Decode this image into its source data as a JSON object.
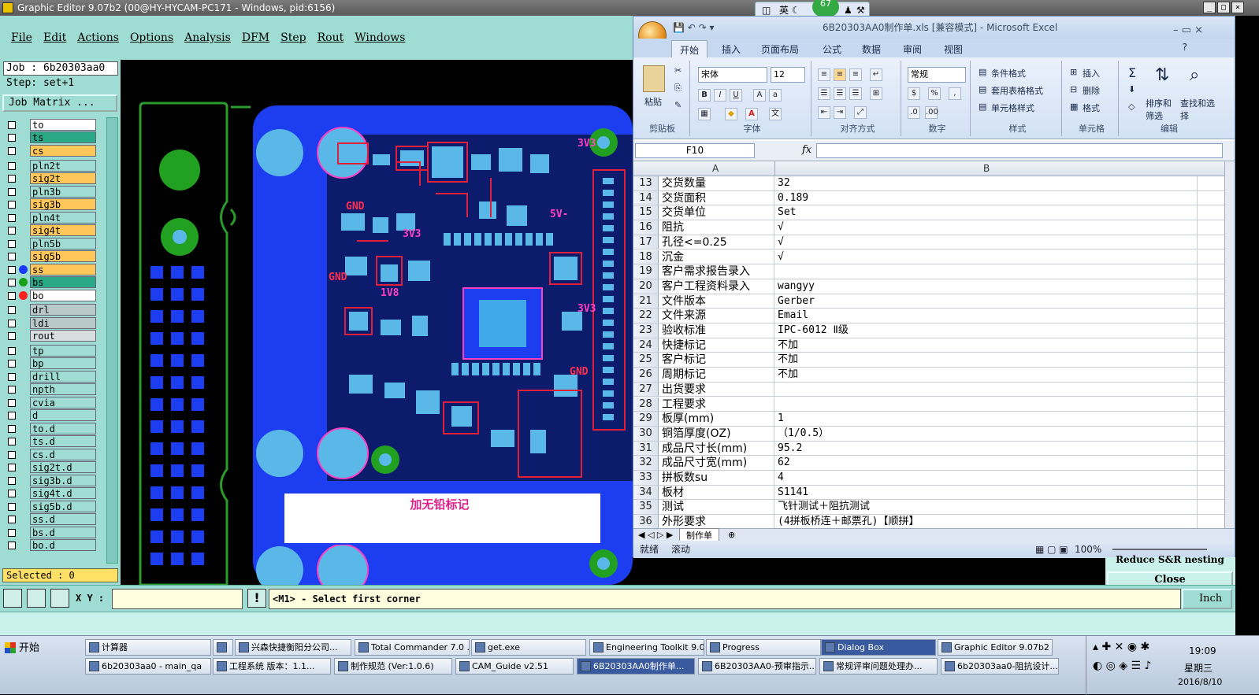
{
  "ge": {
    "title": "Graphic Editor 9.07b2 (00@HY-HYCAM-PC171 - Windows, pid:6156)",
    "menu": [
      "File",
      "Edit",
      "Actions",
      "Options",
      "Analysis",
      "DFM",
      "Step",
      "Rout",
      "Windows"
    ],
    "job": "Job : 6b20303aa0",
    "step": "Step: set+1",
    "job_matrix": "Job Matrix ...",
    "layers": [
      {
        "name": "to",
        "bg": "#ffffff"
      },
      {
        "name": "ts",
        "bg": "#2aa888"
      },
      {
        "name": "cs",
        "bg": "#ffc75a"
      },
      {
        "name": "pln2t",
        "bg": "#9fdcd4"
      },
      {
        "name": "sig2t",
        "bg": "#ffc75a"
      },
      {
        "name": "pln3b",
        "bg": "#9fdcd4"
      },
      {
        "name": "sig3b",
        "bg": "#ffc75a"
      },
      {
        "name": "pln4t",
        "bg": "#9fdcd4"
      },
      {
        "name": "sig4t",
        "bg": "#ffc75a"
      },
      {
        "name": "pln5b",
        "bg": "#9fdcd4"
      },
      {
        "name": "sig5b",
        "bg": "#ffc75a"
      },
      {
        "name": "ss",
        "bg": "#ffc75a",
        "dot": "#1a3aff"
      },
      {
        "name": "bs",
        "bg": "#2aa888",
        "dot": "#18a018"
      },
      {
        "name": "bo",
        "bg": "#ffffff",
        "dot": "#ff2020"
      },
      {
        "name": "drl",
        "bg": "#b9c9c9"
      },
      {
        "name": "ldi",
        "bg": "#b9c9c9"
      },
      {
        "name": "rout",
        "bg": "#d6dede"
      },
      {
        "name": "tp",
        "bg": "#9fdcd4"
      },
      {
        "name": "bp",
        "bg": "#9fdcd4"
      },
      {
        "name": "drill",
        "bg": "#9fdcd4"
      },
      {
        "name": "npth",
        "bg": "#9fdcd4"
      },
      {
        "name": "cvia",
        "bg": "#9fdcd4"
      },
      {
        "name": "d",
        "bg": "#9fdcd4"
      },
      {
        "name": "to.d",
        "bg": "#9fdcd4"
      },
      {
        "name": "ts.d",
        "bg": "#9fdcd4"
      },
      {
        "name": "cs.d",
        "bg": "#9fdcd4"
      },
      {
        "name": "sig2t.d",
        "bg": "#9fdcd4"
      },
      {
        "name": "sig3b.d",
        "bg": "#9fdcd4"
      },
      {
        "name": "sig4t.d",
        "bg": "#9fdcd4"
      },
      {
        "name": "sig5b.d",
        "bg": "#9fdcd4"
      },
      {
        "name": "ss.d",
        "bg": "#9fdcd4"
      },
      {
        "name": "bs.d",
        "bg": "#9fdcd4"
      },
      {
        "name": "bo.d",
        "bg": "#9fdcd4"
      }
    ],
    "selected": "Selected : 0",
    "xy_label": "X Y :",
    "prompt": "<M1> - Select first corner",
    "unit": "Inch",
    "pcb_note": "加无铅标记",
    "side_buttons": [
      "Reduce S&R nesting",
      "Close"
    ],
    "silk_labels": [
      "GND",
      "3V3",
      "5V-",
      "1V8",
      "GND",
      "3V3",
      "GND",
      "3V3"
    ]
  },
  "excel": {
    "title": "6B20303AA0制作单.xls [兼容模式] - Microsoft Excel",
    "tabs": [
      "开始",
      "插入",
      "页面布局",
      "公式",
      "数据",
      "审阅",
      "视图"
    ],
    "groups": [
      "剪贴板",
      "字体",
      "对齐方式",
      "数字",
      "样式",
      "单元格",
      "编辑"
    ],
    "paste": "粘贴",
    "font": "宋体",
    "size": "12",
    "numfmt": "常规",
    "style_items": [
      "条件格式",
      "套用表格格式",
      "单元格样式"
    ],
    "cell_items": [
      "插入",
      "删除",
      "格式"
    ],
    "edit_items": [
      "排序和筛选",
      "查找和选择"
    ],
    "namebox": "F10",
    "fx": "fx",
    "colA": "A",
    "colB": "B",
    "rows": [
      {
        "n": "13",
        "a": "交货数量",
        "b": "32"
      },
      {
        "n": "14",
        "a": "交货面积",
        "b": "0.189"
      },
      {
        "n": "15",
        "a": "交货单位",
        "b": "Set"
      },
      {
        "n": "16",
        "a": "阻抗",
        "b": "√"
      },
      {
        "n": "17",
        "a": "孔径<=0.25",
        "b": "√"
      },
      {
        "n": "18",
        "a": "沉金",
        "b": "√"
      },
      {
        "n": "19",
        "a": "客户需求报告录入",
        "b": ""
      },
      {
        "n": "20",
        "a": "客户工程资料录入",
        "b": "wangyy"
      },
      {
        "n": "21",
        "a": "文件版本",
        "b": "Gerber"
      },
      {
        "n": "22",
        "a": "文件来源",
        "b": "Email"
      },
      {
        "n": "23",
        "a": "验收标准",
        "b": "IPC-6012 Ⅱ级"
      },
      {
        "n": "24",
        "a": "快捷标记",
        "b": "不加"
      },
      {
        "n": "25",
        "a": "客户标记",
        "b": "不加"
      },
      {
        "n": "26",
        "a": "周期标记",
        "b": "不加"
      },
      {
        "n": "27",
        "a": "出货要求",
        "b": ""
      },
      {
        "n": "28",
        "a": "工程要求",
        "b": ""
      },
      {
        "n": "29",
        "a": "板厚(mm)",
        "b": "1"
      },
      {
        "n": "30",
        "a": "铜箔厚度(OZ)",
        "b": "（1/0.5）"
      },
      {
        "n": "31",
        "a": "成品尺寸长(mm)",
        "b": "95.2"
      },
      {
        "n": "32",
        "a": "成品尺寸宽(mm)",
        "b": "62"
      },
      {
        "n": "33",
        "a": "拼板数su",
        "b": "4"
      },
      {
        "n": "34",
        "a": "板材",
        "b": "S1141"
      },
      {
        "n": "35",
        "a": "测试",
        "b": "飞针测试＋阻抗测试"
      },
      {
        "n": "36",
        "a": "外形要求",
        "b": "(4拼板桥连＋邮票孔)【顺拼】"
      }
    ],
    "sheet": "制作单",
    "status_left": "就绪",
    "status_mid": "滚动",
    "zoom": "100%"
  },
  "ime": {
    "label": "英",
    "badge": "67"
  },
  "taskbar": {
    "start": "开始",
    "row1": [
      "计算器",
      "",
      "兴森快捷衡阳分公司...",
      "Total Commander 7.0 ...",
      "get.exe",
      "Engineering Toolkit 9.0...",
      "Progress",
      "Dialog Box",
      "Graphic Editor 9.07b2 ..."
    ],
    "row2": [
      "6b20303aa0 - main_qa",
      "工程系统  版本：1.1...",
      "制作规范 (Ver:1.0.6)",
      "CAM_Guide v2.51",
      "6B20303AA0制作单...",
      "6B20303AA0-预审指示...",
      "常规评审问题处理办...",
      "6b20303aa0-阻抗设计..."
    ],
    "time": "19:09",
    "day": "星期三",
    "date": "2016/8/10"
  }
}
